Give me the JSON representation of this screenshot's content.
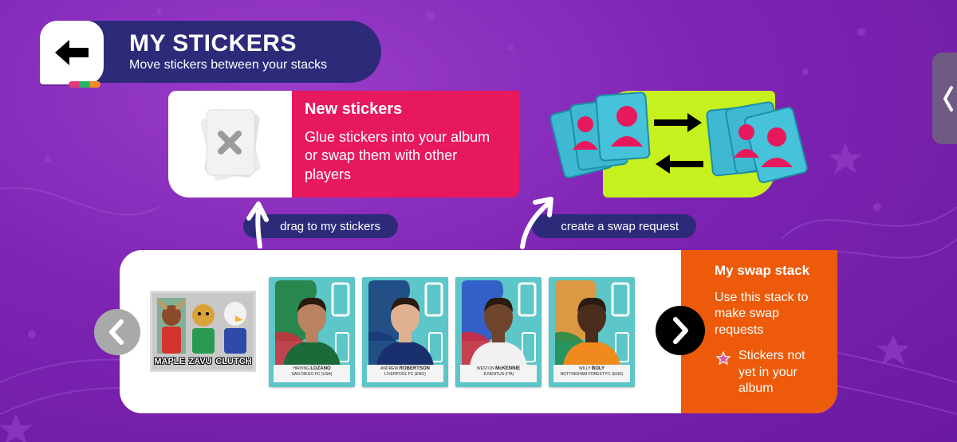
{
  "header": {
    "title": "MY STICKERS",
    "subtitle": "Move stickers between your stacks"
  },
  "new_stickers": {
    "heading": "New stickers",
    "description": "Glue stickers into your album or swap them with other players"
  },
  "hints": {
    "drag": "drag to my stickers",
    "swap": "create a swap request"
  },
  "mascot": {
    "names": [
      "MAPLE",
      "ZAVU",
      "CLUTCH"
    ]
  },
  "stickers": [
    {
      "first": "HIRVING",
      "last": "LOZANO",
      "club": "SAN DIEGO FC (USA)",
      "top": "#1f7a3a",
      "bottom": "#cf2e3b",
      "shirt": "#1b6b3a",
      "skin": "#b98260"
    },
    {
      "first": "ANDREW",
      "last": "ROBERTSON",
      "club": "LIVERPOOL FC (ENG)",
      "top": "#173a7a",
      "bottom": "#173a7a",
      "shirt": "#1a2f6e",
      "skin": "#e0b191"
    },
    {
      "first": "WESTON",
      "last": "McKENNIE",
      "club": "JUVENTUS (ITA)",
      "top": "#2b4fc9",
      "bottom": "#d8283a",
      "shirt": "#f1f1f1",
      "skin": "#6e452c"
    },
    {
      "first": "WILLY",
      "last": "BOLY",
      "club": "NOTTINGHAM FOREST FC (ENG)",
      "top": "#f0902a",
      "bottom": "#1e8a4a",
      "shirt": "#f08a1f",
      "skin": "#4a2d1d"
    }
  ],
  "swap_stack": {
    "heading": "My swap stack",
    "description": "Use this stack to make swap requests",
    "legend": "Stickers not yet in your album"
  },
  "colors": {
    "background": "#7e24b4",
    "navy": "#2d2a7a",
    "pink": "#e8185d",
    "lime": "#c6f01e",
    "orange": "#ed5a0a",
    "sticker_teal": "#5cc6c8"
  },
  "icons": [
    "back-arrow-icon",
    "remove-x-icon",
    "swap-arrows-icon",
    "curved-up-arrow-icon",
    "chevron-left-icon",
    "chevron-right-icon",
    "star-icon",
    "drawer-chevron-icon"
  ]
}
